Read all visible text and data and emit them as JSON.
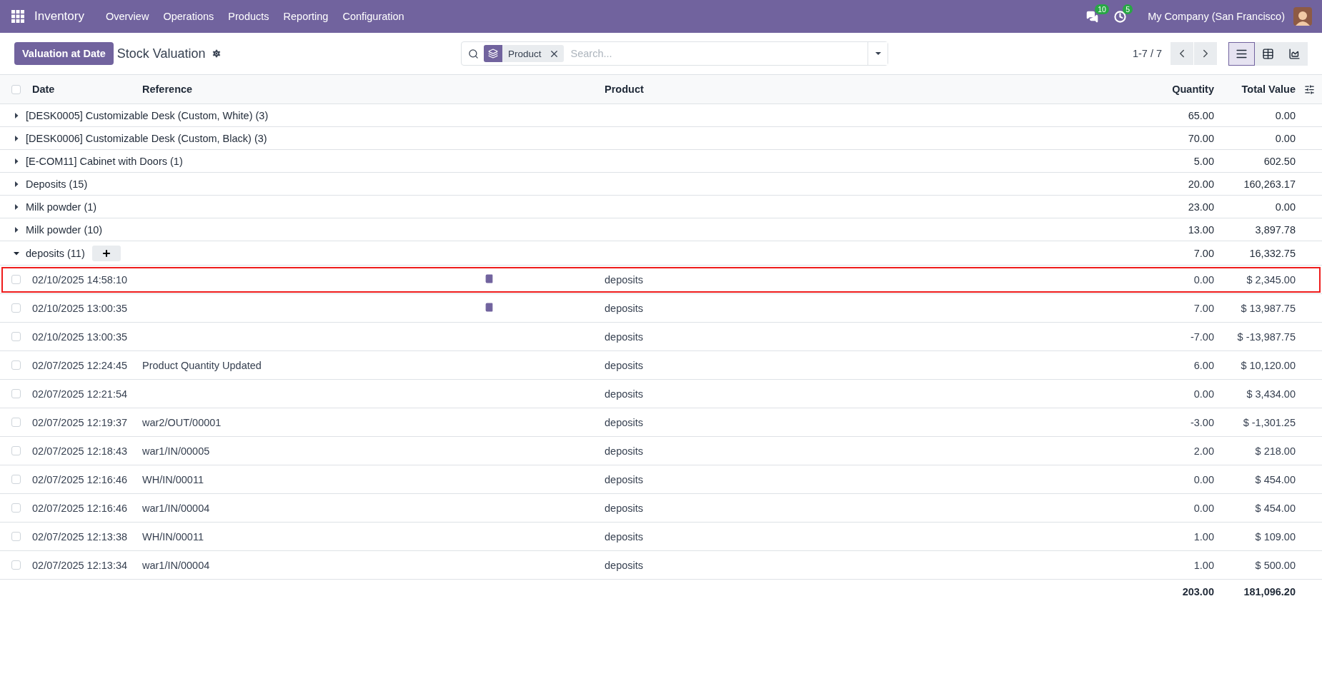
{
  "navbar": {
    "app": "Inventory",
    "menu": [
      "Overview",
      "Operations",
      "Products",
      "Reporting",
      "Configuration"
    ],
    "messages_badge": "10",
    "activities_badge": "5",
    "company": "My Company (San Francisco)"
  },
  "control_panel": {
    "button": "Valuation at Date",
    "title": "Stock Valuation",
    "facet": "Product",
    "search_placeholder": "Search...",
    "pager": "1-7 / 7",
    "views": [
      {
        "kind": "list",
        "selected": true
      },
      {
        "kind": "pivot",
        "selected": false
      },
      {
        "kind": "graph",
        "selected": false
      }
    ]
  },
  "table": {
    "select_all_checked": false,
    "columns": [
      "Date",
      "Reference",
      "Product",
      "Quantity",
      "Total Value"
    ],
    "groups": [
      {
        "label": "[DESK0005] Customizable Desk (Custom, White) (3)",
        "expanded": false,
        "quantity": "65.00",
        "total": "0.00"
      },
      {
        "label": "[DESK0006] Customizable Desk (Custom, Black) (3)",
        "expanded": false,
        "quantity": "70.00",
        "total": "0.00"
      },
      {
        "label": "[E-COM11] Cabinet with Doors (1)",
        "expanded": false,
        "quantity": "5.00",
        "total": "602.50"
      },
      {
        "label": "Deposits (15)",
        "expanded": false,
        "quantity": "20.00",
        "total": "160,263.17"
      },
      {
        "label": "Milk powder (1)",
        "expanded": false,
        "quantity": "23.00",
        "total": "0.00"
      },
      {
        "label": "Milk powder (10)",
        "expanded": false,
        "quantity": "13.00",
        "total": "3,897.78"
      },
      {
        "label": "deposits (11)",
        "expanded": true,
        "quantity": "7.00",
        "total": "16,332.75",
        "records": [
          {
            "date": "02/10/2025 14:58:10",
            "checked": false,
            "accounting_entry": true,
            "product": "deposits",
            "quantity": "0.00",
            "total": "$ 2,345.00",
            "highlighted": true
          },
          {
            "date": "02/10/2025 13:00:35",
            "checked": false,
            "accounting_entry": true,
            "product": "deposits",
            "quantity": "7.00",
            "total": "$ 13,987.75",
            "highlighted": false
          },
          {
            "date": "02/10/2025 13:00:35",
            "checked": false,
            "accounting_entry": false,
            "product": "deposits",
            "quantity": "-7.00",
            "total": "$ -13,987.75",
            "highlighted": false
          },
          {
            "date": "02/07/2025 12:24:45",
            "checked": false,
            "reference": "Product Quantity Updated",
            "accounting_entry": false,
            "product": "deposits",
            "quantity": "6.00",
            "total": "$ 10,120.00",
            "highlighted": false
          },
          {
            "date": "02/07/2025 12:21:54",
            "checked": false,
            "accounting_entry": false,
            "product": "deposits",
            "quantity": "0.00",
            "total": "$ 3,434.00",
            "highlighted": false
          },
          {
            "date": "02/07/2025 12:19:37",
            "checked": false,
            "reference": "war2/OUT/00001",
            "accounting_entry": false,
            "product": "deposits",
            "quantity": "-3.00",
            "total": "$ -1,301.25",
            "highlighted": false
          },
          {
            "date": "02/07/2025 12:18:43",
            "checked": false,
            "reference": "war1/IN/00005",
            "accounting_entry": false,
            "product": "deposits",
            "quantity": "2.00",
            "total": "$ 218.00",
            "highlighted": false
          },
          {
            "date": "02/07/2025 12:16:46",
            "checked": false,
            "reference": "WH/IN/00011",
            "accounting_entry": false,
            "product": "deposits",
            "quantity": "0.00",
            "total": "$ 454.00",
            "highlighted": false
          },
          {
            "date": "02/07/2025 12:16:46",
            "checked": false,
            "reference": "war1/IN/00004",
            "accounting_entry": false,
            "product": "deposits",
            "quantity": "0.00",
            "total": "$ 454.00",
            "highlighted": false
          },
          {
            "date": "02/07/2025 12:13:38",
            "checked": false,
            "reference": "WH/IN/00011",
            "accounting_entry": false,
            "product": "deposits",
            "quantity": "1.00",
            "total": "$ 109.00",
            "highlighted": false
          },
          {
            "date": "02/07/2025 12:13:34",
            "checked": false,
            "reference": "war1/IN/00004",
            "accounting_entry": false,
            "product": "deposits",
            "quantity": "1.00",
            "total": "$ 500.00",
            "highlighted": false
          }
        ]
      }
    ],
    "totals": {
      "quantity": "203.00",
      "total": "181,096.20"
    }
  }
}
